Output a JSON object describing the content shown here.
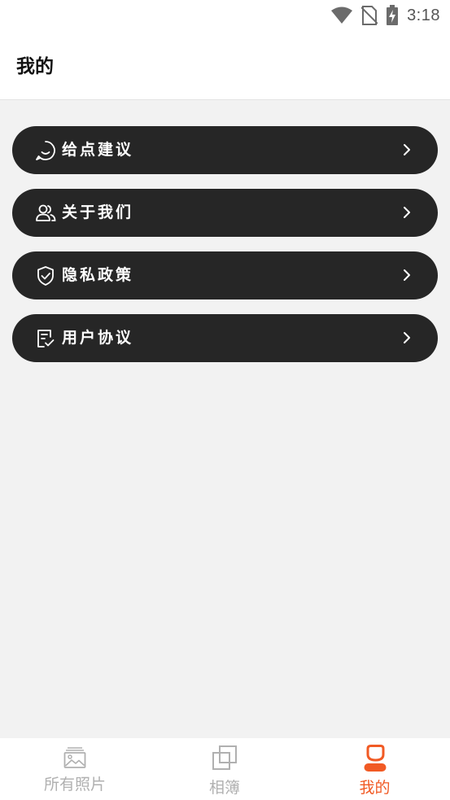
{
  "status_bar": {
    "time": "3:18",
    "icons": [
      "wifi-icon",
      "no-sim-icon",
      "battery-charging-icon"
    ]
  },
  "header": {
    "title": "我的"
  },
  "menu": {
    "items": [
      {
        "label": "给点建议",
        "icon": "chat-smile-icon"
      },
      {
        "label": "关于我们",
        "icon": "users-icon"
      },
      {
        "label": "隐私政策",
        "icon": "shield-check-icon"
      },
      {
        "label": "用户协议",
        "icon": "document-check-icon"
      }
    ]
  },
  "tab_bar": {
    "tabs": [
      {
        "label": "所有照片",
        "icon": "photos-icon",
        "active": false
      },
      {
        "label": "相簿",
        "icon": "albums-icon",
        "active": false
      },
      {
        "label": "我的",
        "icon": "profile-icon",
        "active": true
      }
    ]
  },
  "colors": {
    "accent": "#f15a24",
    "menu_bg": "#262626",
    "page_bg": "#f2f2f2",
    "inactive_tab": "#b0b0b0"
  }
}
